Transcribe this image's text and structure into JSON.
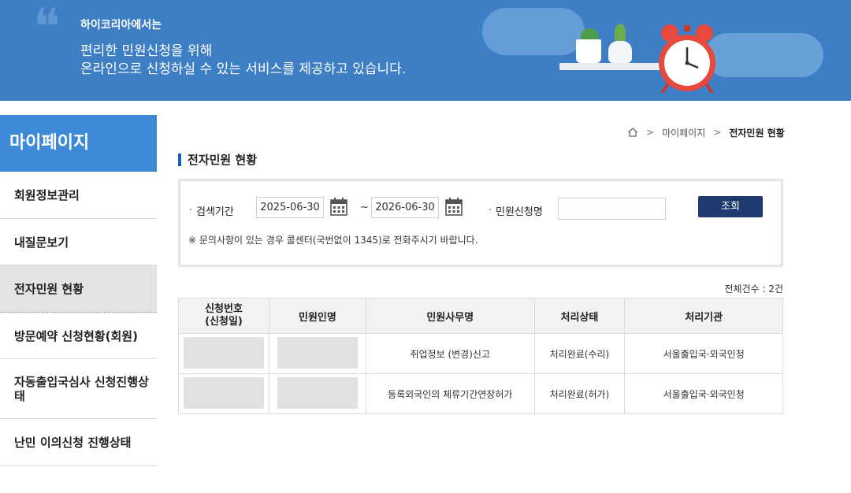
{
  "banner": {
    "sub": "하이코리아에서는",
    "line1": "편리한 민원신청을 위해",
    "line2": "온라인으로 신청하실 수 있는 서비스를 제공하고 있습니다."
  },
  "sidebar": {
    "title": "마이페이지",
    "items": [
      {
        "label": "회원정보관리"
      },
      {
        "label": "내질문보기"
      },
      {
        "label": "전자민원 현황"
      },
      {
        "label": "방문예약 신청현황(회원)"
      },
      {
        "label": "자동출입국심사 신청진행상태"
      },
      {
        "label": "난민 이의신청 진행상태"
      }
    ]
  },
  "breadcrumb": {
    "level1": "마이페이지",
    "current": "전자민원 현황"
  },
  "page_title": "전자민원 현황",
  "search": {
    "period_label": "검색기간",
    "start_date": "2025-06-30",
    "end_date": "2026-06-30",
    "tilde": "~",
    "name_label": "민원신청명",
    "name_value": "",
    "button_label": "조회",
    "notice": "※ 문의사항이 있는 경우 콜센터(국번없이 1345)로 전화주시기 바랍니다."
  },
  "total": "전체건수 : 2건",
  "table": {
    "headers": [
      "신청번호\n(신청일)",
      "민원인명",
      "민원사무명",
      "처리상태",
      "처리기관"
    ],
    "rows": [
      {
        "task": "취업정보 (변경)신고",
        "status": "처리완료(수리)",
        "agency": "서울출입국·외국인청"
      },
      {
        "task": "등록외국인의 체류기간연장허가",
        "status": "처리완료(허가)",
        "agency": "서울출입국·외국인청"
      }
    ]
  },
  "colors": {
    "banner": "#3d7ec4",
    "sidebar_title": "#3f8ad6",
    "button": "#1f3a6e",
    "accent": "#1b5fb4"
  }
}
